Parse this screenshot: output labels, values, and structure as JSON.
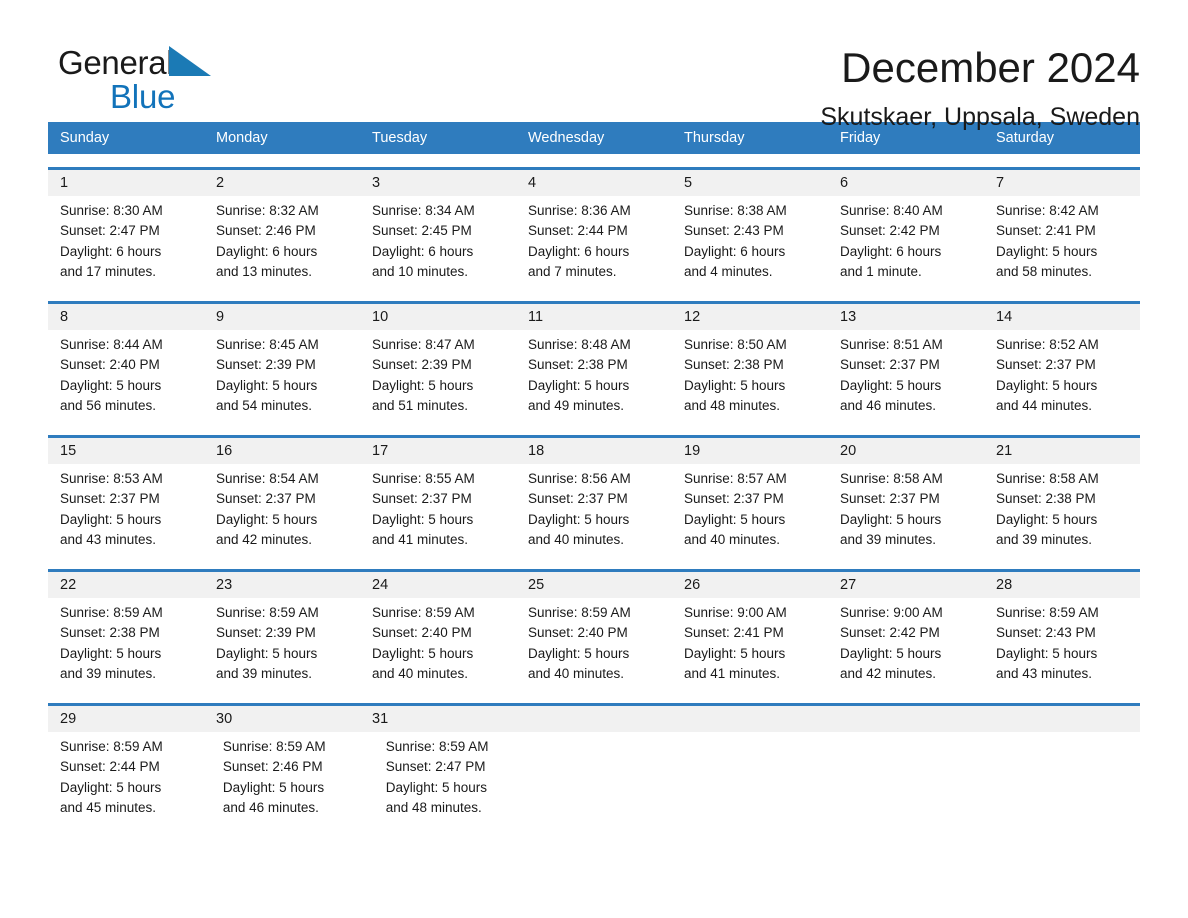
{
  "brand": {
    "name_part1": "General",
    "name_part2": "Blue",
    "triangle_color": "#1b7ab5",
    "blue_color": "#1273ba"
  },
  "header": {
    "month_title": "December 2024",
    "location": "Skutskaer, Uppsala, Sweden"
  },
  "calendar": {
    "header_bg": "#2f7cbe",
    "date_band_bg": "#f1f1f1",
    "weekdays": [
      "Sunday",
      "Monday",
      "Tuesday",
      "Wednesday",
      "Thursday",
      "Friday",
      "Saturday"
    ],
    "weeks": [
      {
        "days": [
          {
            "date": "1",
            "sunrise": "Sunrise: 8:30 AM",
            "sunset": "Sunset: 2:47 PM",
            "daylight_line1": "Daylight: 6 hours",
            "daylight_line2": "and 17 minutes."
          },
          {
            "date": "2",
            "sunrise": "Sunrise: 8:32 AM",
            "sunset": "Sunset: 2:46 PM",
            "daylight_line1": "Daylight: 6 hours",
            "daylight_line2": "and 13 minutes."
          },
          {
            "date": "3",
            "sunrise": "Sunrise: 8:34 AM",
            "sunset": "Sunset: 2:45 PM",
            "daylight_line1": "Daylight: 6 hours",
            "daylight_line2": "and 10 minutes."
          },
          {
            "date": "4",
            "sunrise": "Sunrise: 8:36 AM",
            "sunset": "Sunset: 2:44 PM",
            "daylight_line1": "Daylight: 6 hours",
            "daylight_line2": "and 7 minutes."
          },
          {
            "date": "5",
            "sunrise": "Sunrise: 8:38 AM",
            "sunset": "Sunset: 2:43 PM",
            "daylight_line1": "Daylight: 6 hours",
            "daylight_line2": "and 4 minutes."
          },
          {
            "date": "6",
            "sunrise": "Sunrise: 8:40 AM",
            "sunset": "Sunset: 2:42 PM",
            "daylight_line1": "Daylight: 6 hours",
            "daylight_line2": "and 1 minute."
          },
          {
            "date": "7",
            "sunrise": "Sunrise: 8:42 AM",
            "sunset": "Sunset: 2:41 PM",
            "daylight_line1": "Daylight: 5 hours",
            "daylight_line2": "and 58 minutes."
          }
        ]
      },
      {
        "days": [
          {
            "date": "8",
            "sunrise": "Sunrise: 8:44 AM",
            "sunset": "Sunset: 2:40 PM",
            "daylight_line1": "Daylight: 5 hours",
            "daylight_line2": "and 56 minutes."
          },
          {
            "date": "9",
            "sunrise": "Sunrise: 8:45 AM",
            "sunset": "Sunset: 2:39 PM",
            "daylight_line1": "Daylight: 5 hours",
            "daylight_line2": "and 54 minutes."
          },
          {
            "date": "10",
            "sunrise": "Sunrise: 8:47 AM",
            "sunset": "Sunset: 2:39 PM",
            "daylight_line1": "Daylight: 5 hours",
            "daylight_line2": "and 51 minutes."
          },
          {
            "date": "11",
            "sunrise": "Sunrise: 8:48 AM",
            "sunset": "Sunset: 2:38 PM",
            "daylight_line1": "Daylight: 5 hours",
            "daylight_line2": "and 49 minutes."
          },
          {
            "date": "12",
            "sunrise": "Sunrise: 8:50 AM",
            "sunset": "Sunset: 2:38 PM",
            "daylight_line1": "Daylight: 5 hours",
            "daylight_line2": "and 48 minutes."
          },
          {
            "date": "13",
            "sunrise": "Sunrise: 8:51 AM",
            "sunset": "Sunset: 2:37 PM",
            "daylight_line1": "Daylight: 5 hours",
            "daylight_line2": "and 46 minutes."
          },
          {
            "date": "14",
            "sunrise": "Sunrise: 8:52 AM",
            "sunset": "Sunset: 2:37 PM",
            "daylight_line1": "Daylight: 5 hours",
            "daylight_line2": "and 44 minutes."
          }
        ]
      },
      {
        "days": [
          {
            "date": "15",
            "sunrise": "Sunrise: 8:53 AM",
            "sunset": "Sunset: 2:37 PM",
            "daylight_line1": "Daylight: 5 hours",
            "daylight_line2": "and 43 minutes."
          },
          {
            "date": "16",
            "sunrise": "Sunrise: 8:54 AM",
            "sunset": "Sunset: 2:37 PM",
            "daylight_line1": "Daylight: 5 hours",
            "daylight_line2": "and 42 minutes."
          },
          {
            "date": "17",
            "sunrise": "Sunrise: 8:55 AM",
            "sunset": "Sunset: 2:37 PM",
            "daylight_line1": "Daylight: 5 hours",
            "daylight_line2": "and 41 minutes."
          },
          {
            "date": "18",
            "sunrise": "Sunrise: 8:56 AM",
            "sunset": "Sunset: 2:37 PM",
            "daylight_line1": "Daylight: 5 hours",
            "daylight_line2": "and 40 minutes."
          },
          {
            "date": "19",
            "sunrise": "Sunrise: 8:57 AM",
            "sunset": "Sunset: 2:37 PM",
            "daylight_line1": "Daylight: 5 hours",
            "daylight_line2": "and 40 minutes."
          },
          {
            "date": "20",
            "sunrise": "Sunrise: 8:58 AM",
            "sunset": "Sunset: 2:37 PM",
            "daylight_line1": "Daylight: 5 hours",
            "daylight_line2": "and 39 minutes."
          },
          {
            "date": "21",
            "sunrise": "Sunrise: 8:58 AM",
            "sunset": "Sunset: 2:38 PM",
            "daylight_line1": "Daylight: 5 hours",
            "daylight_line2": "and 39 minutes."
          }
        ]
      },
      {
        "days": [
          {
            "date": "22",
            "sunrise": "Sunrise: 8:59 AM",
            "sunset": "Sunset: 2:38 PM",
            "daylight_line1": "Daylight: 5 hours",
            "daylight_line2": "and 39 minutes."
          },
          {
            "date": "23",
            "sunrise": "Sunrise: 8:59 AM",
            "sunset": "Sunset: 2:39 PM",
            "daylight_line1": "Daylight: 5 hours",
            "daylight_line2": "and 39 minutes."
          },
          {
            "date": "24",
            "sunrise": "Sunrise: 8:59 AM",
            "sunset": "Sunset: 2:40 PM",
            "daylight_line1": "Daylight: 5 hours",
            "daylight_line2": "and 40 minutes."
          },
          {
            "date": "25",
            "sunrise": "Sunrise: 8:59 AM",
            "sunset": "Sunset: 2:40 PM",
            "daylight_line1": "Daylight: 5 hours",
            "daylight_line2": "and 40 minutes."
          },
          {
            "date": "26",
            "sunrise": "Sunrise: 9:00 AM",
            "sunset": "Sunset: 2:41 PM",
            "daylight_line1": "Daylight: 5 hours",
            "daylight_line2": "and 41 minutes."
          },
          {
            "date": "27",
            "sunrise": "Sunrise: 9:00 AM",
            "sunset": "Sunset: 2:42 PM",
            "daylight_line1": "Daylight: 5 hours",
            "daylight_line2": "and 42 minutes."
          },
          {
            "date": "28",
            "sunrise": "Sunrise: 8:59 AM",
            "sunset": "Sunset: 2:43 PM",
            "daylight_line1": "Daylight: 5 hours",
            "daylight_line2": "and 43 minutes."
          }
        ]
      },
      {
        "days": [
          {
            "date": "29",
            "sunrise": "Sunrise: 8:59 AM",
            "sunset": "Sunset: 2:44 PM",
            "daylight_line1": "Daylight: 5 hours",
            "daylight_line2": "and 45 minutes."
          },
          {
            "date": "30",
            "sunrise": "Sunrise: 8:59 AM",
            "sunset": "Sunset: 2:46 PM",
            "daylight_line1": "Daylight: 5 hours",
            "daylight_line2": "and 46 minutes."
          },
          {
            "date": "31",
            "sunrise": "Sunrise: 8:59 AM",
            "sunset": "Sunset: 2:47 PM",
            "daylight_line1": "Daylight: 5 hours",
            "daylight_line2": "and 48 minutes."
          },
          {
            "date": "",
            "sunrise": "",
            "sunset": "",
            "daylight_line1": "",
            "daylight_line2": ""
          },
          {
            "date": "",
            "sunrise": "",
            "sunset": "",
            "daylight_line1": "",
            "daylight_line2": ""
          },
          {
            "date": "",
            "sunrise": "",
            "sunset": "",
            "daylight_line1": "",
            "daylight_line2": ""
          },
          {
            "date": "",
            "sunrise": "",
            "sunset": "",
            "daylight_line1": "",
            "daylight_line2": ""
          }
        ]
      }
    ]
  }
}
